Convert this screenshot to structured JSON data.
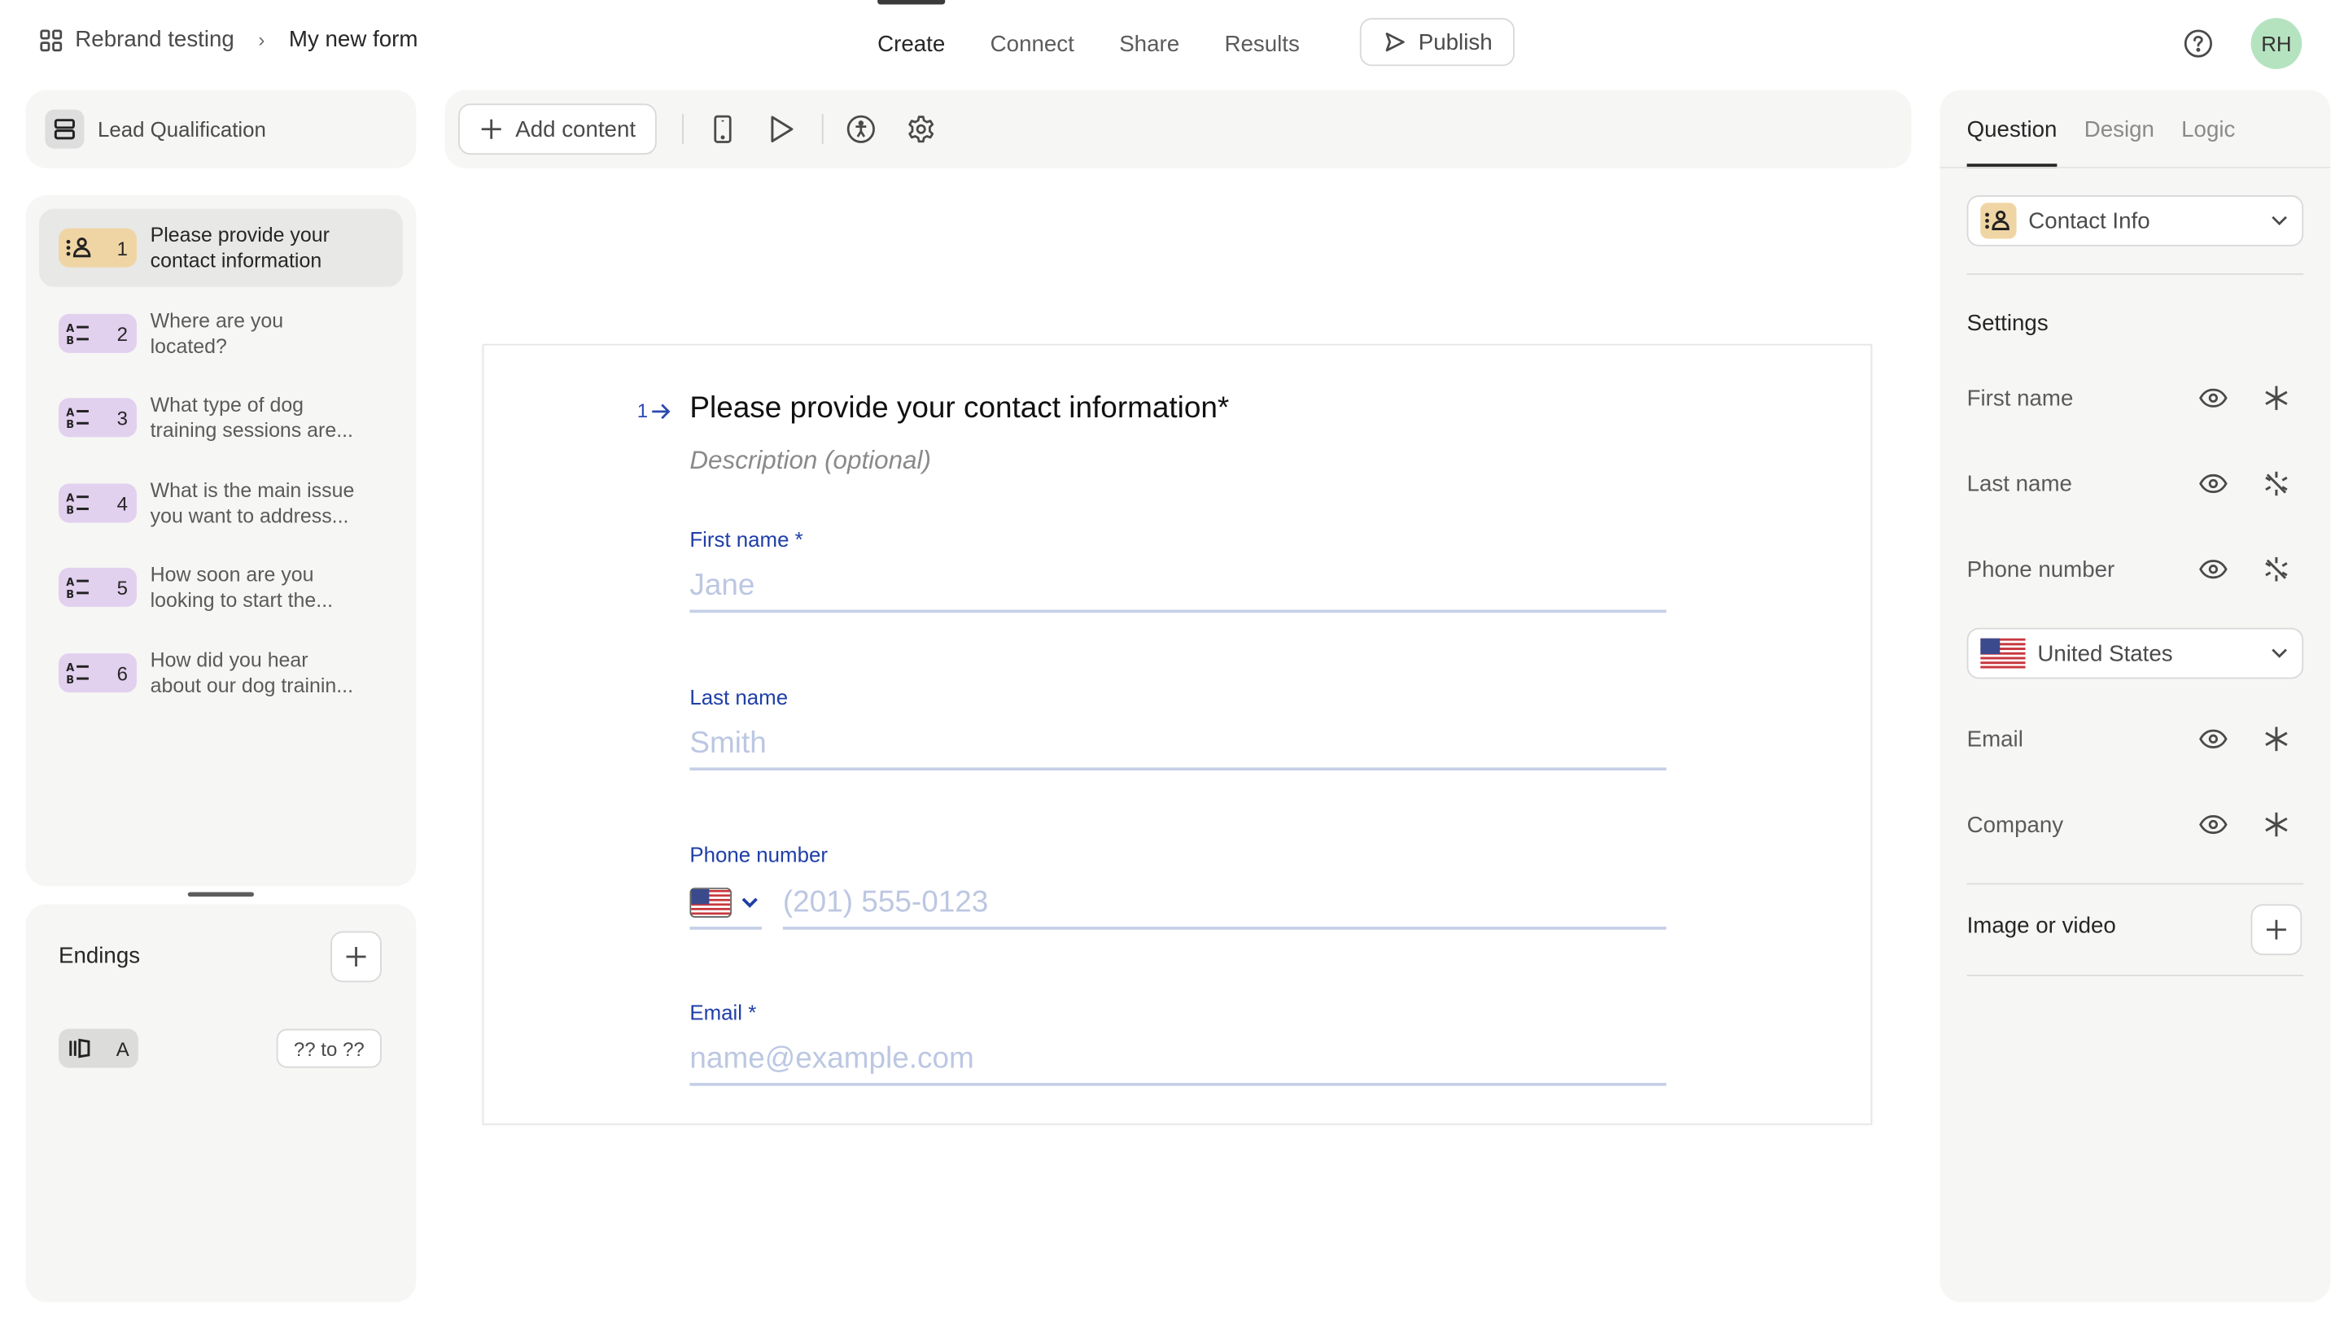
{
  "header": {
    "workspace": "Rebrand testing",
    "form_name": "My new form",
    "tabs": [
      {
        "label": "Create",
        "active": true
      },
      {
        "label": "Connect",
        "active": false
      },
      {
        "label": "Share",
        "active": false
      },
      {
        "label": "Results",
        "active": false
      }
    ],
    "publish_label": "Publish",
    "avatar_initials": "RH",
    "avatar_color": "#b5e3c0"
  },
  "left": {
    "form_type_label": "Lead Qualification",
    "questions": [
      {
        "num": "1",
        "type": "contact-info",
        "text_1": "Please provide your",
        "text_2": "contact information",
        "color": "#f0d5a4",
        "selected": true
      },
      {
        "num": "2",
        "type": "multiple-choice",
        "text_1": "Where are you",
        "text_2": "located?",
        "color": "#e2d0ef",
        "selected": false
      },
      {
        "num": "3",
        "type": "multiple-choice",
        "text_1": "What type of dog",
        "text_2": "training sessions are...",
        "color": "#e2d0ef",
        "selected": false
      },
      {
        "num": "4",
        "type": "multiple-choice",
        "text_1": "What is the main issue",
        "text_2": "you want to address...",
        "color": "#e2d0ef",
        "selected": false
      },
      {
        "num": "5",
        "type": "multiple-choice",
        "text_1": "How soon are you",
        "text_2": "looking to start the...",
        "color": "#e2d0ef",
        "selected": false
      },
      {
        "num": "6",
        "type": "multiple-choice",
        "text_1": "How did you hear",
        "text_2": "about our dog trainin...",
        "color": "#e2d0ef",
        "selected": false
      }
    ],
    "endings": {
      "title": "Endings",
      "items": [
        {
          "label": "A",
          "range": "?? to ??"
        }
      ]
    }
  },
  "toolbar": {
    "add_content_label": "Add content"
  },
  "form": {
    "question_number": "1",
    "title": "Please provide your contact information*",
    "description_placeholder": "Description (optional)",
    "fields": {
      "first_name": {
        "label": "First name *",
        "placeholder": "Jane"
      },
      "last_name": {
        "label": "Last name",
        "placeholder": "Smith"
      },
      "phone": {
        "label": "Phone number",
        "placeholder": "(201) 555-0123",
        "country": "US"
      },
      "email": {
        "label": "Email *",
        "placeholder": "name@example.com"
      }
    },
    "accent_color": "#1f3fa6"
  },
  "right": {
    "tabs": [
      {
        "label": "Question",
        "active": true
      },
      {
        "label": "Design",
        "active": false
      },
      {
        "label": "Logic",
        "active": false
      }
    ],
    "question_type": "Contact Info",
    "settings_title": "Settings",
    "fields": [
      {
        "label": "First name",
        "visible": true,
        "required": true
      },
      {
        "label": "Last name",
        "visible": true,
        "required": false
      },
      {
        "label": "Phone number",
        "visible": true,
        "required": false
      },
      {
        "label": "Email",
        "visible": true,
        "required": true
      },
      {
        "label": "Company",
        "visible": true,
        "required": true
      }
    ],
    "default_country": "United States",
    "image_or_video_label": "Image or video"
  }
}
